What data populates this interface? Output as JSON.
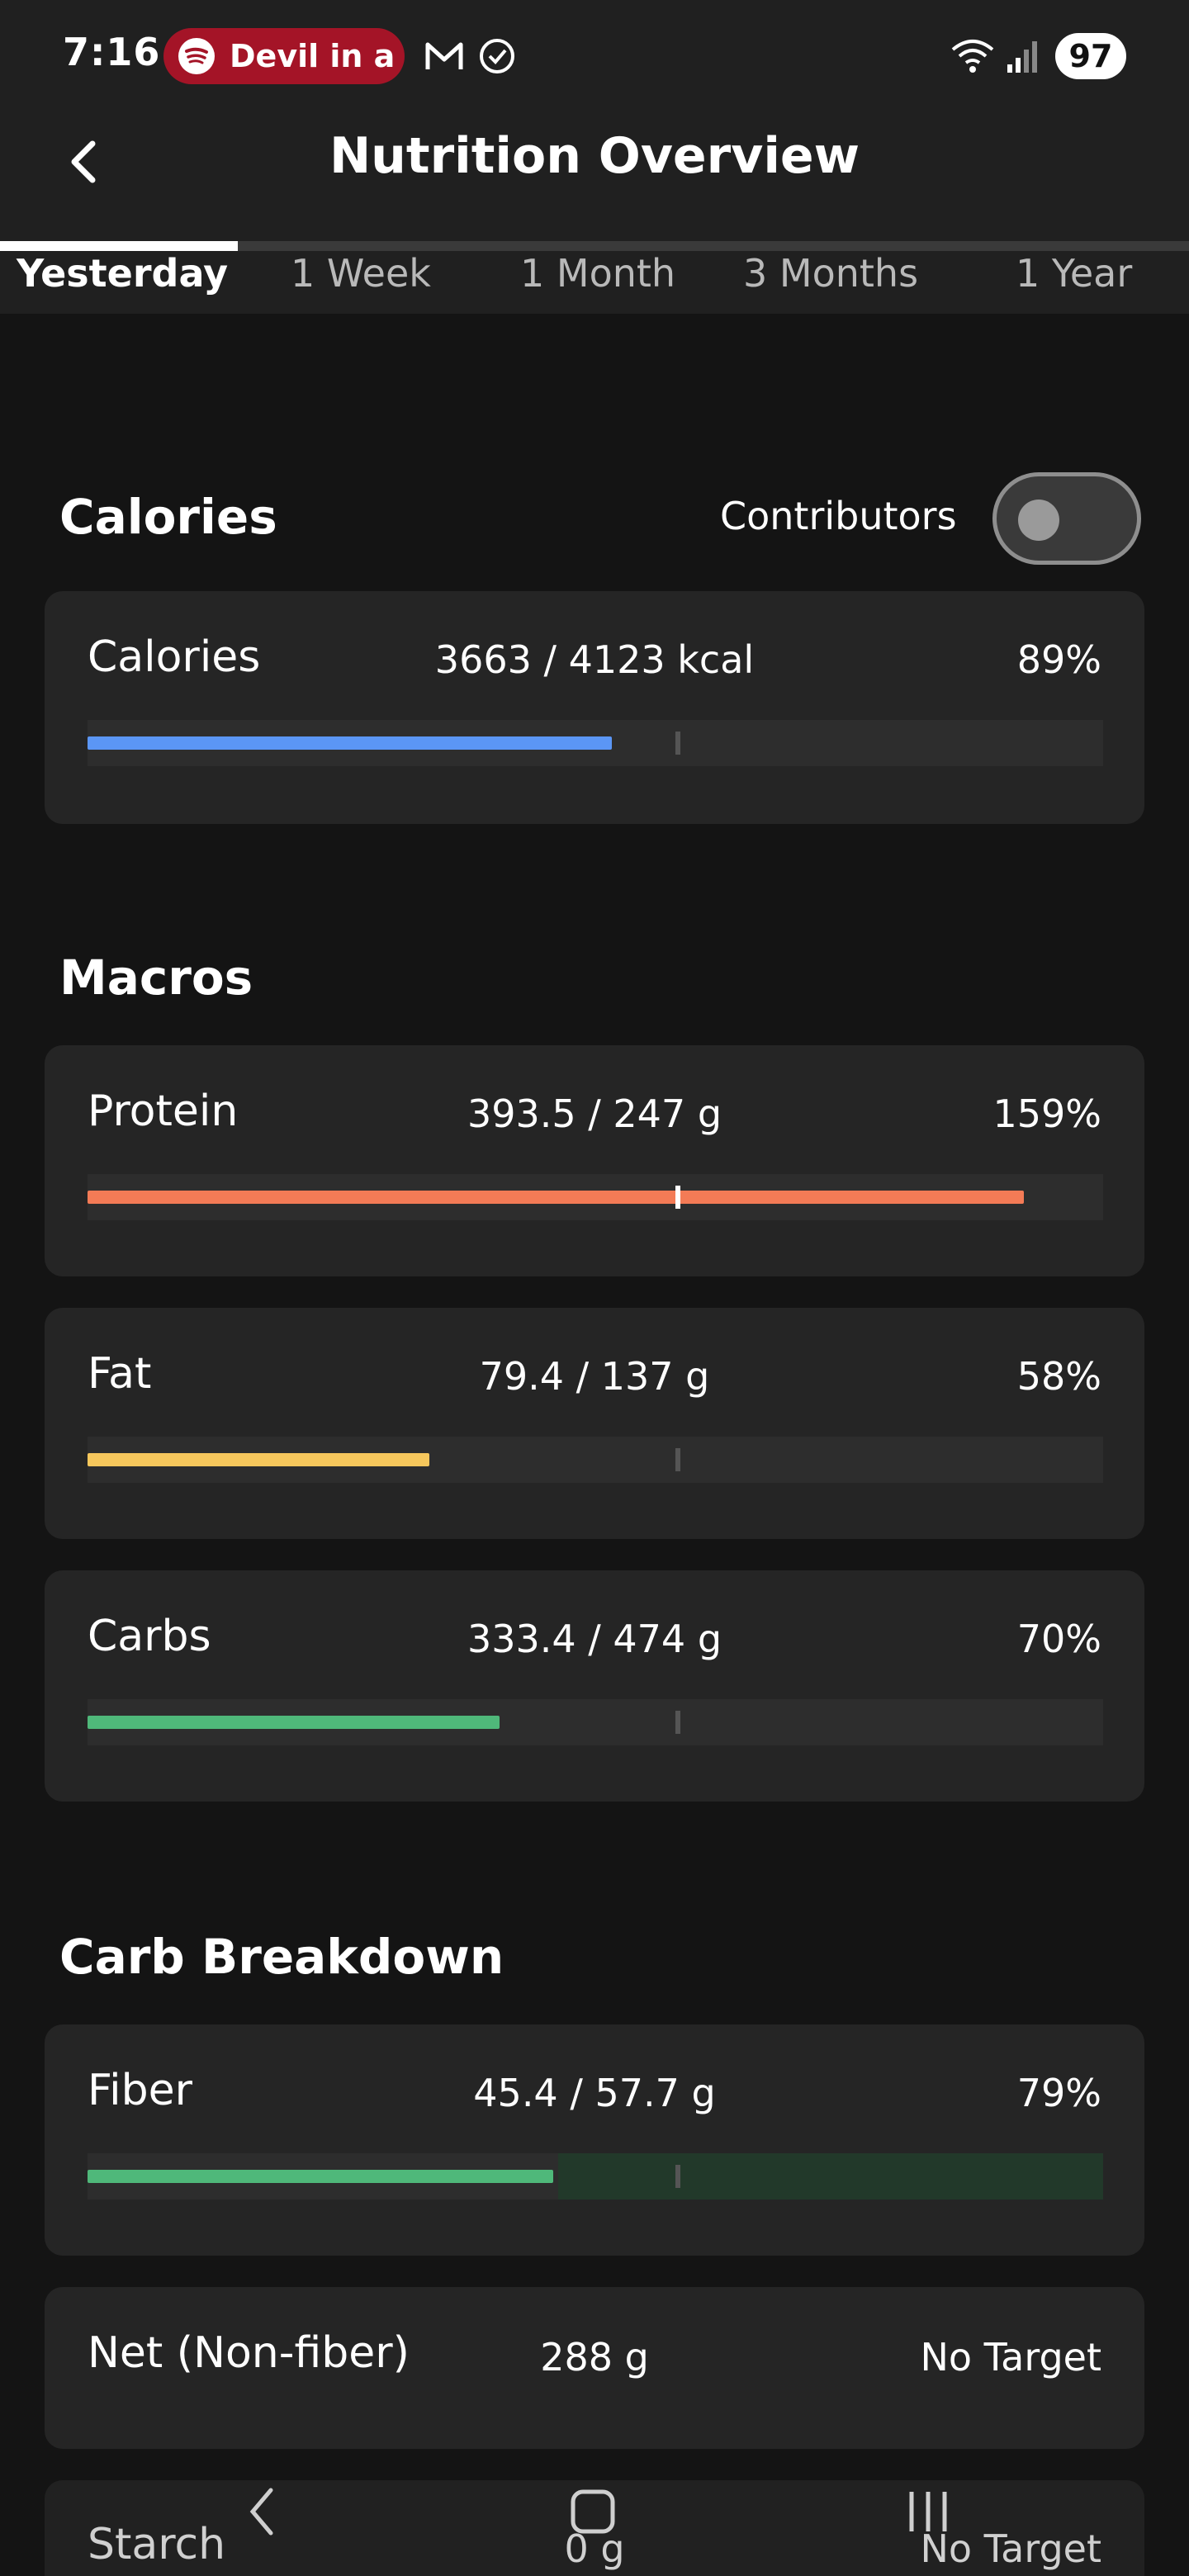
{
  "status": {
    "time": "7:16",
    "media_text": "Devil in a",
    "battery": "97"
  },
  "header": {
    "title": "Nutrition Overview"
  },
  "tabs": [
    {
      "label": "Yesterday",
      "active": true
    },
    {
      "label": "1 Week"
    },
    {
      "label": "1 Month"
    },
    {
      "label": "3 Months"
    },
    {
      "label": "1 Year"
    }
  ],
  "calories": {
    "section_title": "Calories",
    "contributors_label": "Contributors",
    "contributors_on": false,
    "card": {
      "name": "Calories",
      "amount": "3663 / 4123 kcal",
      "pct": "89%",
      "fill_fraction": 0.89,
      "color": "#5b96f5"
    }
  },
  "macros": {
    "section_title": "Macros",
    "items": [
      {
        "name": "Protein",
        "amount": "393.5 / 247 g",
        "pct": "159%",
        "fill_fraction": 1.59,
        "color": "#f47b56"
      },
      {
        "name": "Fat",
        "amount": "79.4 / 137 g",
        "pct": "58%",
        "fill_fraction": 0.58,
        "color": "#f6c75c"
      },
      {
        "name": "Carbs",
        "amount": "333.4 / 474 g",
        "pct": "70%",
        "fill_fraction": 0.7,
        "color": "#4fb87a"
      }
    ]
  },
  "carb_breakdown": {
    "section_title": "Carb Breakdown",
    "fiber": {
      "name": "Fiber",
      "amount": "45.4 / 57.7 g",
      "pct": "79%",
      "fill_fraction": 0.79,
      "color": "#4fb87a",
      "target_band_color": "#22392a"
    },
    "net": {
      "name": "Net (Non-fiber)",
      "amount": "288 g",
      "target": "No Target"
    },
    "starch": {
      "name": "Starch",
      "amount": "0 g",
      "target": "No Target"
    }
  }
}
